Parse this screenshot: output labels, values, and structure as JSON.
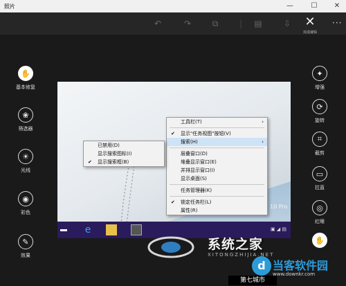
{
  "window": {
    "title": "照片",
    "minimize": "—",
    "maximize": "☐",
    "close": "✕"
  },
  "toolbar": {
    "close_icon": "✕",
    "close_label": "完成编辑",
    "more": "···"
  },
  "left_tools": [
    {
      "label": "基本修复",
      "icon": "hand-icon",
      "glyph": "✋"
    },
    {
      "label": "筛选器",
      "icon": "filter-icon",
      "glyph": "❀"
    },
    {
      "label": "光线",
      "icon": "sun-icon",
      "glyph": "☀"
    },
    {
      "label": "彩色",
      "icon": "palette-icon",
      "glyph": "◉"
    },
    {
      "label": "效果",
      "icon": "brush-icon",
      "glyph": "✎"
    }
  ],
  "right_tools": [
    {
      "label": "增强",
      "icon": "magic-wand-icon",
      "glyph": "✦"
    },
    {
      "label": "旋转",
      "icon": "rotate-icon",
      "glyph": "⟳"
    },
    {
      "label": "截剪",
      "icon": "crop-icon",
      "glyph": "⌗"
    },
    {
      "label": "拉直",
      "icon": "straighten-icon",
      "glyph": "▭"
    },
    {
      "label": "红眼",
      "icon": "eye-icon",
      "glyph": "◎"
    },
    {
      "label": "",
      "icon": "touch-icon",
      "glyph": "✋"
    }
  ],
  "photo": {
    "edition_text": "10 Pro"
  },
  "taskbar_menu": {
    "items": [
      {
        "label": "工具栏(T)",
        "check": "",
        "arrow": "›"
      },
      {
        "label": "显示\"任务视图\"按钮(V)",
        "check": "✔",
        "arrow": ""
      },
      {
        "label": "搜索(H)",
        "check": "",
        "arrow": "›"
      },
      {
        "label": "层叠窗口(D)",
        "check": "",
        "arrow": ""
      },
      {
        "label": "堆叠显示窗口(E)",
        "check": "",
        "arrow": ""
      },
      {
        "label": "并排显示窗口(I)",
        "check": "",
        "arrow": ""
      },
      {
        "label": "显示桌面(S)",
        "check": "",
        "arrow": ""
      },
      {
        "label": "任务管理器(K)",
        "check": "",
        "arrow": ""
      },
      {
        "label": "锁定任务栏(L)",
        "check": "✔",
        "arrow": ""
      },
      {
        "label": "属性(R)",
        "check": "",
        "arrow": ""
      }
    ]
  },
  "search_submenu": {
    "items": [
      {
        "label": "已禁用(D)",
        "check": ""
      },
      {
        "label": "显示搜索图标(I)",
        "check": ""
      },
      {
        "label": "显示搜索框(B)",
        "check": "✔"
      }
    ]
  },
  "taskbar": {
    "tray_icon": "notification-icon"
  },
  "watermarks": {
    "site_name": "系统之家",
    "site_sub": "XITONGZHIJIA.NET",
    "dk_logo": "d",
    "dk_name": "当客软件园",
    "dk_url": "www.downkr.com",
    "footer": "第七城市"
  }
}
